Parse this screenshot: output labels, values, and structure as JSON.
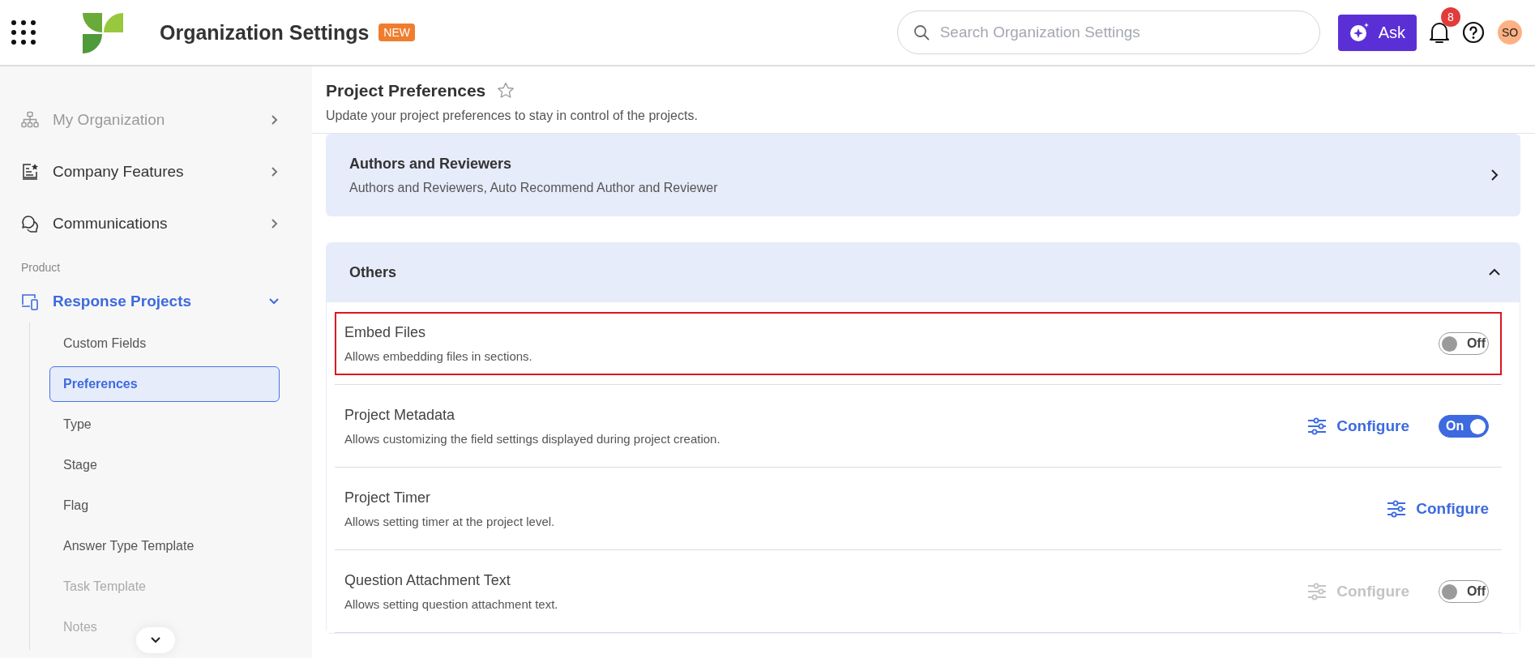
{
  "header": {
    "title": "Organization Settings",
    "badge": "NEW",
    "search": {
      "placeholder": "Search Organization Settings"
    },
    "ask_button": "Ask",
    "notifications": "8",
    "avatar": "SO"
  },
  "sidebar": {
    "items": [
      {
        "label": "My Organization",
        "dimmed": true
      },
      {
        "label": "Company Features",
        "dimmed": false
      },
      {
        "label": "Communications",
        "dimmed": false
      }
    ],
    "section": "Product",
    "group": {
      "label": "Response Projects",
      "expanded": true,
      "children": [
        {
          "label": "Custom Fields",
          "selected": false,
          "dimmed": false
        },
        {
          "label": "Preferences",
          "selected": true,
          "dimmed": false
        },
        {
          "label": "Type",
          "selected": false,
          "dimmed": false
        },
        {
          "label": "Stage",
          "selected": false,
          "dimmed": false
        },
        {
          "label": "Flag",
          "selected": false,
          "dimmed": false
        },
        {
          "label": "Answer Type Template",
          "selected": false,
          "dimmed": false
        },
        {
          "label": "Task Template",
          "selected": false,
          "dimmed": true
        },
        {
          "label": "Notes",
          "selected": false,
          "dimmed": true
        }
      ]
    }
  },
  "page": {
    "title": "Project Preferences",
    "description": "Update your project preferences to stay in control of the projects."
  },
  "cards": [
    {
      "title": "Authors and Reviewers",
      "subtitle": "Authors and Reviewers, Auto Recommend Author and Reviewer",
      "expanded": false
    },
    {
      "title": "Others",
      "expanded": true,
      "rows": [
        {
          "title": "Embed Files",
          "description": "Allows embedding files in sections.",
          "highlighted": true,
          "toggle": {
            "on": false,
            "label": "Off"
          }
        },
        {
          "title": "Project Metadata",
          "description": "Allows customizing the field settings displayed during project creation.",
          "highlighted": false,
          "configure": {
            "label": "Configure",
            "disabled": false
          },
          "toggle": {
            "on": true,
            "label": "On"
          }
        },
        {
          "title": "Project Timer",
          "description": "Allows setting timer at the project level.",
          "highlighted": false,
          "configure": {
            "label": "Configure",
            "disabled": false
          }
        },
        {
          "title": "Question Attachment Text",
          "description": "Allows setting question attachment text.",
          "highlighted": false,
          "configure": {
            "label": "Configure",
            "disabled": true
          },
          "toggle": {
            "on": false,
            "label": "Off"
          }
        }
      ]
    }
  ]
}
